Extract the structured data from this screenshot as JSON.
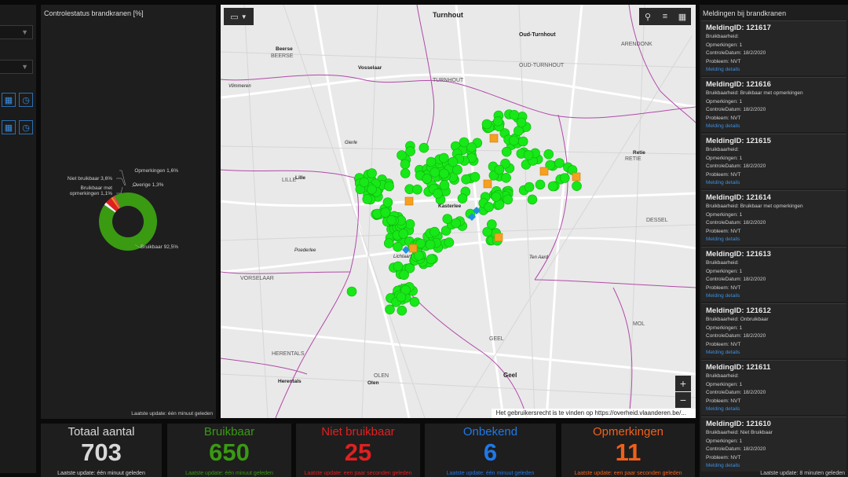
{
  "chart": {
    "title": "Controlestatus brandkranen [%]",
    "footer": "Laatste update: één minuut geleden",
    "labels": {
      "opmerkingen": "Opmerkingen 1,6%",
      "niet_bruikbaar": "Niet bruikbaar 3,6%",
      "bruikbaar_opm": "Bruikbaar met",
      "bruikbaar_opm2": "opmerkingen 1,1%",
      "overige": "Overige 1,3%",
      "bruikbaar": "Bruikbaar 92,5%"
    }
  },
  "chart_data": {
    "type": "pie",
    "title": "Controlestatus brandkranen [%]",
    "categories": [
      "Bruikbaar",
      "Opmerkingen",
      "Niet bruikbaar",
      "Bruikbaar met opmerkingen",
      "Overige"
    ],
    "values": [
      92.5,
      1.6,
      3.6,
      1.1,
      1.3
    ],
    "colors": [
      "#3a9a12",
      "#f1f1f1",
      "#e02020",
      "#f08a20",
      "#d85050"
    ]
  },
  "map": {
    "places": {
      "turnhout": "Turnhout",
      "oud_turnhout": "Oud-Turnhout",
      "oud_turnhout_caps": "OUD-TURNHOUT",
      "turnhout_caps": "TURNHOUT",
      "arendonk": "ARENDONK",
      "beerse": "Beerse",
      "beerse_caps": "BEERSE",
      "vosselaar": "Vosselaar",
      "vlimmeren": "Vlimmeren",
      "gierle": "Gierle",
      "retie": "Retie",
      "retie_caps": "RETIE",
      "lille": "Lille",
      "lille_caps": "LILLE",
      "kasterlee": "Kasterlee",
      "dessel": "DESSEL",
      "poederlee": "Poederlee",
      "lichtaart": "Lichtaart",
      "ten_aard": "Ten Aard",
      "vorselaar": "VORSELAAR",
      "geel_caps": "GEEL",
      "mol": "MOL",
      "herentals_caps": "HERENTALS",
      "herentals": "Herentals",
      "olen_caps": "OLEN",
      "olen": "Olen",
      "geel": "Geel"
    },
    "attribution": "Het gebruikersrecht is te vinden op https://overheid.vlaanderen.be/..."
  },
  "list": {
    "title": "Meldingen bij brandkranen",
    "footer": "Laatste update: 8 minuten geleden",
    "items": [
      {
        "id": "MeldingID: 121617",
        "bruik": "Bruikbaarheid:",
        "opm": "Opmerkingen: 1",
        "datum": "ControleDatum: 18/2/2020",
        "prob": "Probleem: NVT",
        "link": "Melding details"
      },
      {
        "id": "MeldingID: 121616",
        "bruik": "Bruikbaarheid: Bruikbaar met opmerkingen",
        "opm": "Opmerkingen: 1",
        "datum": "ControleDatum: 18/2/2020",
        "prob": "Probleem: NVT",
        "link": "Melding details"
      },
      {
        "id": "MeldingID: 121615",
        "bruik": "Bruikbaarheid:",
        "opm": "Opmerkingen: 1",
        "datum": "ControleDatum: 18/2/2020",
        "prob": "Probleem: NVT",
        "link": "Melding details"
      },
      {
        "id": "MeldingID: 121614",
        "bruik": "Bruikbaarheid: Bruikbaar met opmerkingen",
        "opm": "Opmerkingen: 1",
        "datum": "ControleDatum: 18/2/2020",
        "prob": "Probleem: NVT",
        "link": "Melding details"
      },
      {
        "id": "MeldingID: 121613",
        "bruik": "Bruikbaarheid:",
        "opm": "Opmerkingen: 1",
        "datum": "ControleDatum: 18/2/2020",
        "prob": "Probleem: NVT",
        "link": "Melding details"
      },
      {
        "id": "MeldingID: 121612",
        "bruik": "Bruikbaarheid: Onbruikbaar",
        "opm": "Opmerkingen: 1",
        "datum": "ControleDatum: 18/2/2020",
        "prob": "Probleem: NVT",
        "link": "Melding details"
      },
      {
        "id": "MeldingID: 121611",
        "bruik": "Bruikbaarheid:",
        "opm": "Opmerkingen: 1",
        "datum": "ControleDatum: 18/2/2020",
        "prob": "Probleem: NVT",
        "link": "Melding details"
      },
      {
        "id": "MeldingID: 121610",
        "bruik": "Bruikbaarheid: Niet Bruikbaar",
        "opm": "Opmerkingen: 1",
        "datum": "ControleDatum: 18/2/2020",
        "prob": "Probleem: NVT",
        "link": "Melding details"
      }
    ]
  },
  "stats": [
    {
      "label": "Totaal aantal",
      "value": "703",
      "update": "Laatste update: één minuut geleden",
      "color": "#d8d8d8"
    },
    {
      "label": "Bruikbaar",
      "value": "650",
      "update": "Laatste update: één minuut geleden",
      "color": "#3a9a12"
    },
    {
      "label": "Niet bruikbaar",
      "value": "25",
      "update": "Laatste update: een paar seconden geleden",
      "color": "#e02020"
    },
    {
      "label": "Onbekend",
      "value": "6",
      "update": "Laatste update: één minuut geleden",
      "color": "#1f78e8"
    },
    {
      "label": "Opmerkingen",
      "value": "11",
      "update": "Laatste update: een paar seconden geleden",
      "color": "#f0601a"
    }
  ]
}
